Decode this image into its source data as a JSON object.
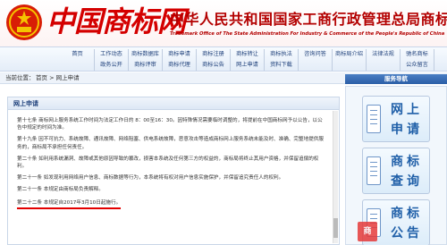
{
  "header": {
    "logo_text": "中国商标网",
    "title": "中华人民共和国国家工商行政管理总局商标局",
    "subtitle": "Trademark Office of The State Administration For Industry & Commerce of the People's Republic of China"
  },
  "nav": {
    "row1": [
      "首页",
      "工作动态",
      "商标数据库",
      "商标申请",
      "商标注册",
      "商标转让",
      "商标执法",
      "咨询问答",
      "商标局介绍",
      "法律法规",
      "驰名商标"
    ],
    "row2": [
      "",
      "政务公开",
      "商标评审",
      "商标代理",
      "商标公告",
      "网上申请",
      "资料下载",
      "",
      "",
      "",
      "公众留言"
    ]
  },
  "location": {
    "label": "当前位置：",
    "path": "首页 > 网上申请"
  },
  "service_nav": {
    "title": "服务导航",
    "items": [
      {
        "label": "网上申请",
        "icon": "document-icon"
      },
      {
        "label": "商标查询",
        "icon": "search-document-icon"
      },
      {
        "label": "商标公告",
        "icon": "bulletin-icon"
      }
    ]
  },
  "main": {
    "title": "网上申请",
    "paragraphs": [
      "第十七条  商标网上服务系统工作时间为法定工作日的 8：00至16：30。因特殊情况需要临时调整的，将提前在中国商标网予以公告，以公告中规定的时间为准。",
      "第十九条  因不可抗力、系统故障、通讯故障、网络阻塞、供电系统故障，恶意攻击等造成商标网上服务系统未能及时、准确、完整地提供服务的，商标局不承担任何责任。",
      "第二十条  如利用系统漏洞、故障或其他原因导致的篡改，损害本系统及任何第三方的权益的，商标局将终止其用户资格，并保留追偿的权利。",
      "第二十一条  如发现利用网络用户信息、商标数据等行为，本系统将有权对用户信息实施保护，并保留追究责任人的权利。",
      "第二十一条  本规定由商标局负责解释。",
      "第二十二条  本规定自2017年3月10日起施行。"
    ],
    "highlight_index": 5
  },
  "watermark": "商"
}
